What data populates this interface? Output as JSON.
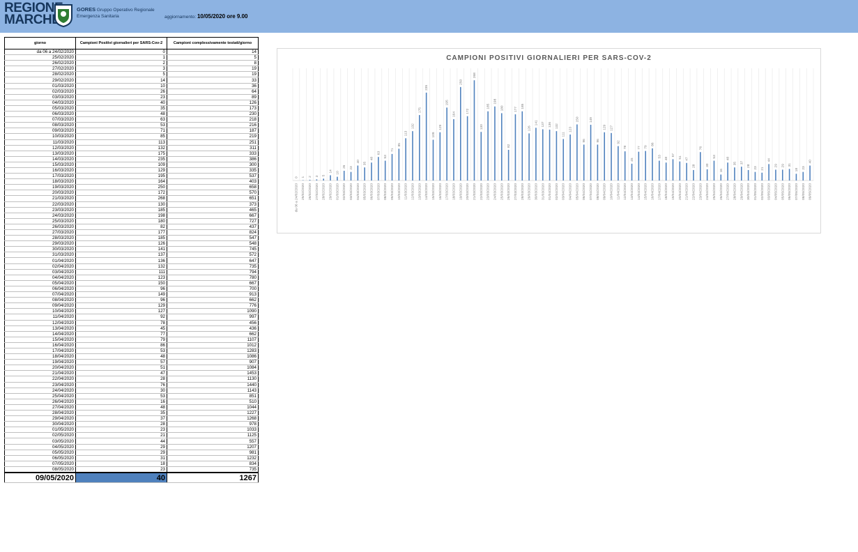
{
  "header": {
    "logo_line1": "REGIONE",
    "logo_line2": "MARCHE",
    "org_name": "GORES",
    "org_desc_1": "Gruppo Operativo Regionale",
    "org_desc_2": "Emergenza Sanitaria",
    "update_label": "aggiornamento:",
    "update_value": "10/05/2020 ore 9.00"
  },
  "table": {
    "headers": [
      "giorno",
      "Campioni Positivi giornalieri per SARS-Cov-2",
      "Campioni complessivamente testati/giorno"
    ],
    "rows": [
      [
        "da 06 a 24/02/2020",
        "0",
        "14"
      ],
      [
        "25/02/2020",
        "1",
        "5"
      ],
      [
        "26/02/2020",
        "2",
        "8"
      ],
      [
        "27/02/2020",
        "3",
        "19"
      ],
      [
        "28/02/2020",
        "5",
        "19"
      ],
      [
        "29/02/2020",
        "14",
        "33"
      ],
      [
        "01/03/2020",
        "10",
        "36"
      ],
      [
        "02/03/2020",
        "26",
        "64"
      ],
      [
        "03/03/2020",
        "23",
        "89"
      ],
      [
        "04/03/2020",
        "40",
        "126"
      ],
      [
        "05/03/2020",
        "35",
        "173"
      ],
      [
        "06/03/2020",
        "48",
        "230"
      ],
      [
        "07/03/2020",
        "63",
        "218"
      ],
      [
        "08/03/2020",
        "53",
        "216"
      ],
      [
        "09/03/2020",
        "71",
        "187"
      ],
      [
        "10/03/2020",
        "85",
        "219"
      ],
      [
        "11/03/2020",
        "113",
        "251"
      ],
      [
        "12/03/2020",
        "132",
        "311"
      ],
      [
        "13/03/2020",
        "175",
        "333"
      ],
      [
        "14/03/2020",
        "235",
        "386"
      ],
      [
        "15/03/2020",
        "109",
        "300"
      ],
      [
        "16/03/2020",
        "129",
        "335"
      ],
      [
        "17/03/2020",
        "195",
        "537"
      ],
      [
        "18/03/2020",
        "164",
        "403"
      ],
      [
        "19/03/2020",
        "250",
        "658"
      ],
      [
        "20/03/2020",
        "172",
        "570"
      ],
      [
        "21/03/2020",
        "268",
        "651"
      ],
      [
        "22/03/2020",
        "130",
        "373"
      ],
      [
        "23/03/2020",
        "185",
        "465"
      ],
      [
        "24/03/2020",
        "198",
        "667"
      ],
      [
        "25/03/2020",
        "180",
        "727"
      ],
      [
        "26/03/2020",
        "82",
        "437"
      ],
      [
        "27/03/2020",
        "177",
        "824"
      ],
      [
        "28/03/2020",
        "185",
        "547"
      ],
      [
        "29/03/2020",
        "126",
        "548"
      ],
      [
        "30/03/2020",
        "141",
        "745"
      ],
      [
        "31/03/2020",
        "137",
        "572"
      ],
      [
        "01/04/2020",
        "136",
        "647"
      ],
      [
        "02/04/2020",
        "132",
        "735"
      ],
      [
        "03/04/2020",
        "111",
        "794"
      ],
      [
        "04/04/2020",
        "123",
        "780"
      ],
      [
        "05/04/2020",
        "150",
        "667"
      ],
      [
        "06/04/2020",
        "96",
        "700"
      ],
      [
        "07/04/2020",
        "149",
        "913"
      ],
      [
        "08/04/2020",
        "96",
        "662"
      ],
      [
        "09/04/2020",
        "129",
        "776"
      ],
      [
        "10/04/2020",
        "127",
        "1090"
      ],
      [
        "11/04/2020",
        "92",
        "997"
      ],
      [
        "12/04/2020",
        "78",
        "456"
      ],
      [
        "13/04/2020",
        "45",
        "436"
      ],
      [
        "14/04/2020",
        "77",
        "662"
      ],
      [
        "15/04/2020",
        "79",
        "1107"
      ],
      [
        "16/04/2020",
        "86",
        "1012"
      ],
      [
        "17/04/2020",
        "53",
        "1283"
      ],
      [
        "18/04/2020",
        "48",
        "1086"
      ],
      [
        "19/04/2020",
        "57",
        "907"
      ],
      [
        "20/04/2020",
        "51",
        "1084"
      ],
      [
        "21/04/2020",
        "47",
        "1453"
      ],
      [
        "22/04/2020",
        "28",
        "1130"
      ],
      [
        "23/04/2020",
        "76",
        "1440"
      ],
      [
        "24/04/2020",
        "30",
        "1143"
      ],
      [
        "25/04/2020",
        "53",
        "851"
      ],
      [
        "26/04/2020",
        "16",
        "510"
      ],
      [
        "27/04/2020",
        "48",
        "1044"
      ],
      [
        "28/04/2020",
        "35",
        "1227"
      ],
      [
        "29/04/2020",
        "37",
        "1268"
      ],
      [
        "30/04/2020",
        "28",
        "978"
      ],
      [
        "01/05/2020",
        "23",
        "1033"
      ],
      [
        "02/05/2020",
        "21",
        "1125"
      ],
      [
        "03/05/2020",
        "44",
        "557"
      ],
      [
        "04/05/2020",
        "29",
        "1207"
      ],
      [
        "05/05/2020",
        "29",
        "981"
      ],
      [
        "06/05/2020",
        "31",
        "1232"
      ],
      [
        "07/05/2020",
        "18",
        "834"
      ],
      [
        "08/05/2020",
        "23",
        "735"
      ]
    ],
    "last_row": [
      "09/05/2020",
      "40",
      "1267"
    ]
  },
  "chart_data": {
    "type": "bar",
    "title": "CAMPIONI POSITIVI GIORNALIERI PER SARS-COV-2",
    "color": "#4f81bd",
    "grid": true,
    "categories": [
      "da 06 a 24/02/2020",
      "25/02/2020",
      "26/02/2020",
      "27/02/2020",
      "28/02/2020",
      "29/02/2020",
      "01/03/2020",
      "02/03/2020",
      "03/03/2020",
      "04/03/2020",
      "05/03/2020",
      "06/03/2020",
      "07/03/2020",
      "08/03/2020",
      "09/03/2020",
      "10/03/2020",
      "11/03/2020",
      "12/03/2020",
      "13/03/2020",
      "14/03/2020",
      "15/03/2020",
      "16/03/2020",
      "17/03/2020",
      "18/03/2020",
      "19/03/2020",
      "20/03/2020",
      "21/03/2020",
      "22/03/2020",
      "23/03/2020",
      "24/03/2020",
      "25/03/2020",
      "26/03/2020",
      "27/03/2020",
      "28/03/2020",
      "29/03/2020",
      "30/03/2020",
      "31/03/2020",
      "01/04/2020",
      "02/04/2020",
      "03/04/2020",
      "04/04/2020",
      "05/04/2020",
      "06/04/2020",
      "07/04/2020",
      "08/04/2020",
      "09/04/2020",
      "10/04/2020",
      "11/04/2020",
      "12/04/2020",
      "13/04/2020",
      "14/04/2020",
      "15/04/2020",
      "16/04/2020",
      "17/04/2020",
      "18/04/2020",
      "19/04/2020",
      "20/04/2020",
      "21/04/2020",
      "22/04/2020",
      "23/04/2020",
      "24/04/2020",
      "25/04/2020",
      "26/04/2020",
      "27/04/2020",
      "28/04/2020",
      "29/04/2020",
      "30/04/2020",
      "01/05/2020",
      "02/05/2020",
      "03/05/2020",
      "04/05/2020",
      "05/05/2020",
      "06/05/2020",
      "07/05/2020",
      "08/05/2020",
      "09/05/2020"
    ],
    "values": [
      0,
      1,
      2,
      3,
      5,
      14,
      10,
      26,
      23,
      40,
      35,
      48,
      63,
      53,
      71,
      85,
      113,
      132,
      175,
      235,
      109,
      129,
      195,
      164,
      250,
      172,
      268,
      130,
      185,
      198,
      180,
      82,
      177,
      185,
      126,
      141,
      137,
      136,
      132,
      111,
      123,
      150,
      96,
      149,
      96,
      129,
      127,
      92,
      78,
      45,
      77,
      79,
      86,
      53,
      48,
      57,
      51,
      47,
      28,
      76,
      30,
      53,
      16,
      48,
      35,
      37,
      28,
      23,
      21,
      44,
      29,
      29,
      31,
      18,
      23,
      40
    ],
    "ylim": [
      0,
      300
    ]
  }
}
